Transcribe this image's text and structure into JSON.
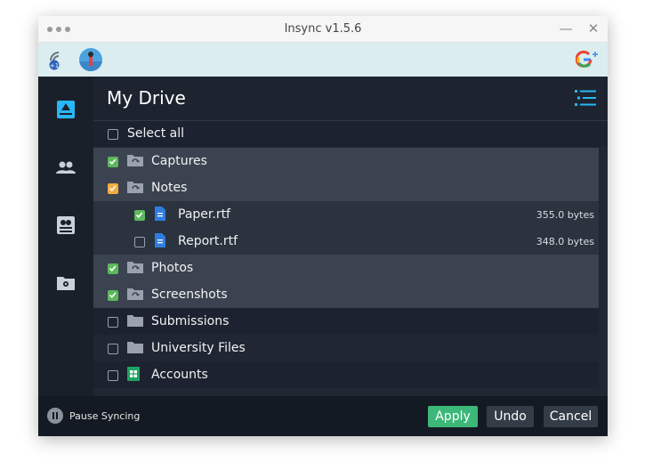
{
  "window": {
    "title": "Insync v1.5.6",
    "minimize_glyph": "—",
    "close_glyph": "✕"
  },
  "accountbar": {
    "left_icons": [
      "network-status-icon",
      "user-avatar"
    ],
    "right_icon": "google-plus-icon"
  },
  "sidebar": {
    "items": [
      {
        "name": "my-drive",
        "icon": "drive-icon",
        "active": true
      },
      {
        "name": "shared",
        "icon": "people-icon",
        "active": false
      },
      {
        "name": "accounts",
        "icon": "account-card-icon",
        "active": false
      },
      {
        "name": "settings",
        "icon": "folder-settings-icon",
        "active": false
      }
    ]
  },
  "header": {
    "title": "My Drive"
  },
  "select_all": {
    "label": "Select all",
    "checked": false
  },
  "files": [
    {
      "name": "Captures",
      "kind": "shared-folder",
      "check": "green",
      "size": ""
    },
    {
      "name": "Notes",
      "kind": "shared-folder",
      "check": "partial",
      "size": ""
    },
    {
      "name": "Paper.rtf",
      "kind": "doc",
      "check": "green",
      "size": "355.0 bytes",
      "child": true
    },
    {
      "name": "Report.rtf",
      "kind": "doc",
      "check": "none",
      "size": "348.0 bytes",
      "child": true
    },
    {
      "name": "Photos",
      "kind": "shared-folder",
      "check": "green",
      "size": ""
    },
    {
      "name": "Screenshots",
      "kind": "shared-folder",
      "check": "green",
      "size": ""
    },
    {
      "name": "Submissions",
      "kind": "folder",
      "check": "none",
      "size": ""
    },
    {
      "name": "University Files",
      "kind": "folder",
      "check": "none",
      "size": ""
    },
    {
      "name": "Accounts",
      "kind": "sheet",
      "check": "none",
      "size": ""
    }
  ],
  "footer": {
    "pause_label": "Pause Syncing",
    "apply_label": "Apply",
    "undo_label": "Undo",
    "cancel_label": "Cancel"
  },
  "colors": {
    "accent_blue": "#29b6f6",
    "check_green": "#5cb85c",
    "check_partial": "#f0ad3e",
    "apply_green": "#3cb878"
  }
}
